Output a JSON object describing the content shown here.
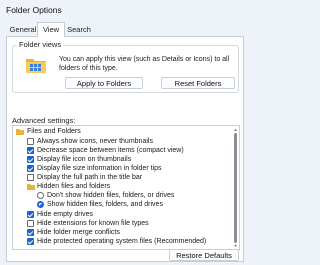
{
  "window": {
    "title": "Folder Options"
  },
  "tabs": [
    {
      "label": "General"
    },
    {
      "label": "View"
    },
    {
      "label": "Search"
    }
  ],
  "folder_views": {
    "label": "Folder views",
    "description": "You can apply this view (such as Details or Icons) to all folders of this type.",
    "apply_button": "Apply to Folders",
    "reset_button": "Reset Folders"
  },
  "advanced": {
    "label": "Advanced settings:",
    "items": [
      {
        "label": "Files and Folders",
        "type": "category"
      },
      {
        "label": "Always show icons, never thumbnails",
        "type": "checkbox",
        "checked": false
      },
      {
        "label": "Decrease space between items (compact view)",
        "type": "checkbox",
        "checked": true
      },
      {
        "label": "Display file icon on thumbnails",
        "type": "checkbox",
        "checked": true
      },
      {
        "label": "Display file size information in folder tips",
        "type": "checkbox",
        "checked": true
      },
      {
        "label": "Display the full path in the title bar",
        "type": "checkbox",
        "checked": false
      },
      {
        "label": "Hidden files and folders",
        "type": "folder"
      },
      {
        "label": "Don't show hidden files, folders, or drives",
        "type": "radio",
        "checked": false
      },
      {
        "label": "Show hidden files, folders, and drives",
        "type": "radio",
        "checked": true
      },
      {
        "label": "Hide empty drives",
        "type": "checkbox",
        "checked": true
      },
      {
        "label": "Hide extensions for known file types",
        "type": "checkbox",
        "checked": false
      },
      {
        "label": "Hide folder merge conflicts",
        "type": "checkbox",
        "checked": true
      },
      {
        "label": "Hide protected operating system files (Recommended)",
        "type": "checkbox",
        "checked": true
      }
    ]
  },
  "footer": {
    "restore_button": "Restore Defaults"
  },
  "colors": {
    "accent": "#1f63c8",
    "background": "#eef3f9"
  }
}
